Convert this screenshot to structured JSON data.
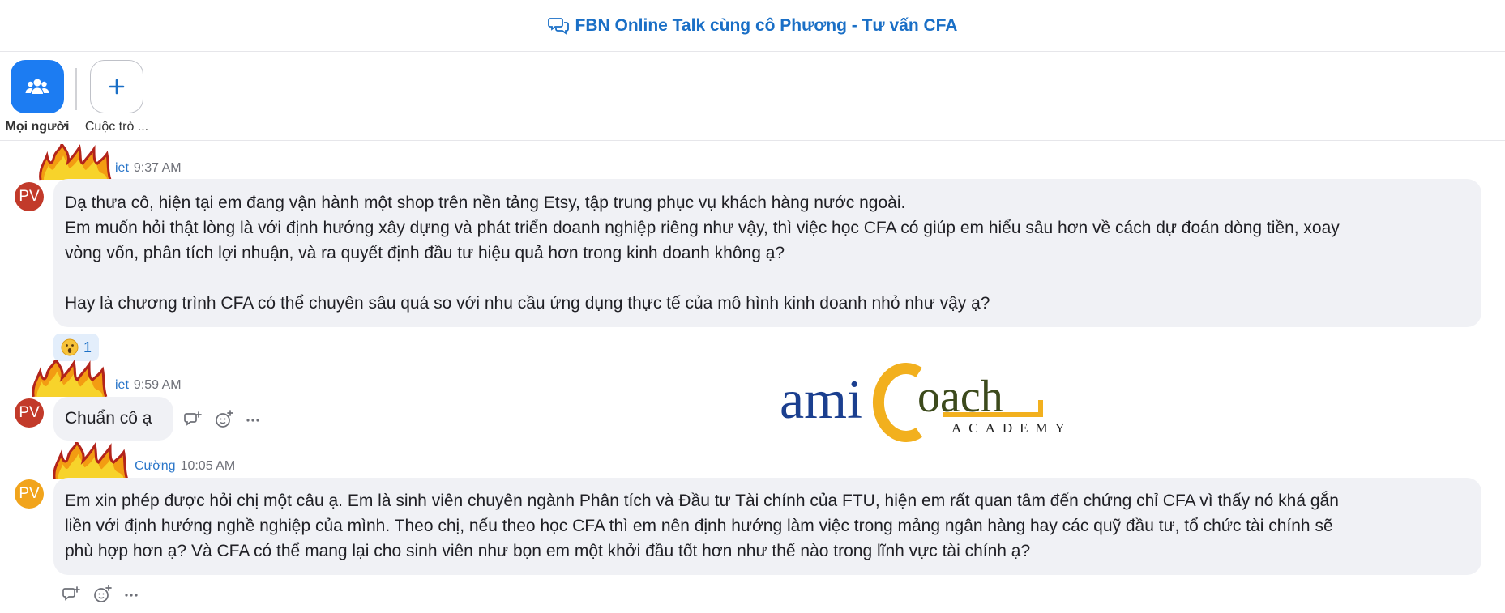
{
  "header": {
    "title": "FBN Online Talk cùng cô Phương - Tư vấn CFA"
  },
  "tabs": [
    {
      "label": "Mọi người",
      "icon": "people-icon",
      "active": true
    },
    {
      "label": "Cuộc trò ...",
      "icon": "plus-icon",
      "active": false
    }
  ],
  "messages": [
    {
      "avatar": "PV",
      "sender": "iet",
      "time": "9:37 AM",
      "lines": [
        "Dạ thưa cô, hiện tại em đang vận hành một shop trên nền tảng Etsy, tập trung phục vụ khách hàng nước ngoài.",
        "Em muốn hỏi thật lòng là với định hướng xây dựng và phát triển doanh nghiệp riêng như vậy, thì việc học CFA có giúp em hiểu sâu hơn về cách dự đoán dòng tiền, xoay",
        "vòng vốn, phân tích lợi nhuận, và ra quyết định đầu tư hiệu quả hơn trong kinh doanh không ạ?",
        "Hay là chương trình CFA có thể chuyên sâu quá so với nhu cầu ứng dụng thực tế của mô hình kinh doanh nhỏ như vậy ạ?"
      ],
      "reaction": {
        "emoji": "surprised-face-emoji",
        "count": "1"
      }
    },
    {
      "avatar": "PV",
      "sender": "iet",
      "time": "9:59 AM",
      "text": "Chuẩn cô ạ"
    },
    {
      "avatar": "PV",
      "sender": "Cường",
      "time": "10:05 AM",
      "lines": [
        "Em xin phép được hỏi chị một câu ạ. Em là sinh viên chuyên ngành Phân tích và Đầu tư Tài chính của FTU, hiện em rất quan tâm đến chứng chỉ CFA vì thấy nó khá gắn",
        "liền với định hướng nghề nghiệp của mình. Theo chị, nếu theo học CFA thì em nên định hướng làm việc trong mảng ngân hàng hay các quỹ đầu tư, tổ chức tài chính sẽ",
        "phù hợp hơn ạ? Và CFA có thể mang lại cho sinh viên như bọn em một khởi đầu tốt hơn như thế nào trong lĩnh vực tài chính ạ?"
      ]
    }
  ],
  "watermark": {
    "brand_left": "ami",
    "brand_right": "oach",
    "sub": "ACADEMY"
  },
  "colors": {
    "accent": "#1a6fc6",
    "tab_active": "#1c7cf2",
    "avatar_red": "#c23a2a",
    "avatar_orange": "#f1a41c",
    "bubble": "#f0f1f5"
  }
}
